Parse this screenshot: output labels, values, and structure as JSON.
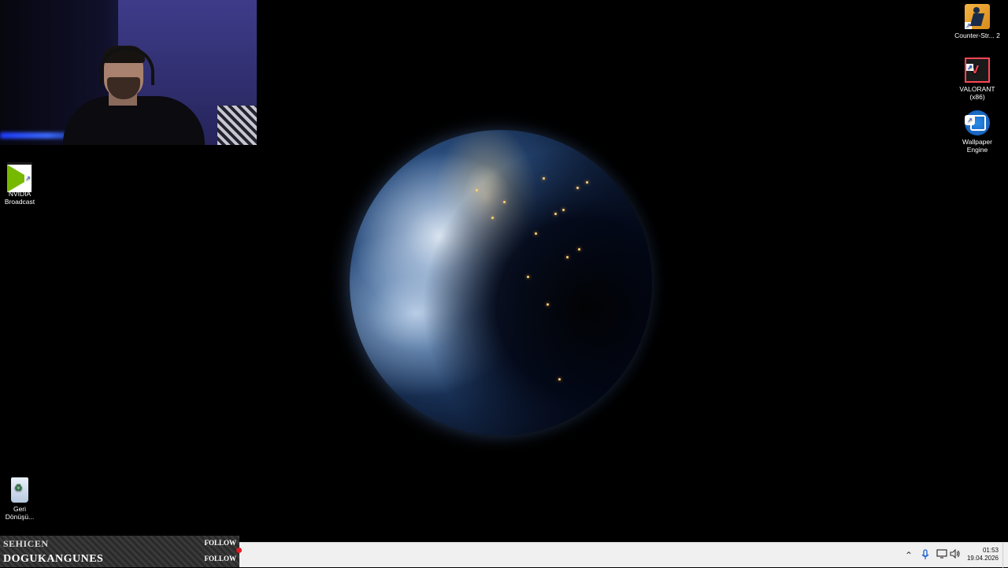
{
  "desktop": {
    "icons": [
      {
        "id": "cs2",
        "label": "Counter-Str... 2"
      },
      {
        "id": "valorant",
        "label_line1": "VALORANT",
        "label_line2": "(x86)"
      },
      {
        "id": "wallpaper",
        "label_line1": "Wallpaper",
        "label_line2": "Engine"
      },
      {
        "id": "nvidia",
        "label_line1": "NVIDIA",
        "label_line2": "Broadcast"
      },
      {
        "id": "recycle",
        "label_line1": "Geri",
        "label_line2": "Dönüşü..."
      }
    ]
  },
  "overlay": {
    "followers": [
      {
        "name": "SEHICEN",
        "action": "FOLLOW"
      },
      {
        "name": "DOGUKANGUNES",
        "action": "FOLLOW"
      }
    ]
  },
  "taskbar": {
    "time": "01:53",
    "date": "19.04.2026",
    "tray_icons": [
      "chevron-up-icon",
      "microphone-icon",
      "display-icon",
      "speaker-icon"
    ]
  }
}
